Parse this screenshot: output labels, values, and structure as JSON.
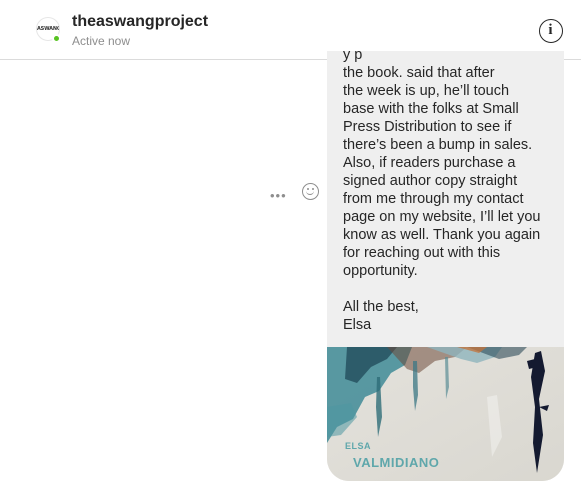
{
  "header": {
    "username": "theaswangproject",
    "status": "Active now",
    "avatar_text": "ASWANG",
    "info_glyph": "i"
  },
  "thread": {
    "more_glyph": "•••",
    "message_lines": [
      "the book.         said that after",
      "the week is up, he’ll touch",
      "base with the folks at Small",
      "Press Distribution to see if",
      "there’s been a bump in sales.",
      "Also, if readers purchase a",
      "signed author copy straight",
      "from me through my contact",
      "page on my website, I’ll let you",
      "know as well. Thank you again",
      "for reaching out with this",
      "opportunity."
    ],
    "signoff_lines": [
      "All the best,",
      "Elsa"
    ],
    "image": {
      "title": "ELSA",
      "author": "VALMIDIANO"
    }
  },
  "colors": {
    "active_dot": "#58c322",
    "bubble": "#efefef",
    "cover_text": "#5fa7ab"
  },
  "icons": {
    "info": "info-icon",
    "more": "more-options-icon",
    "react": "smiley-face-icon"
  }
}
